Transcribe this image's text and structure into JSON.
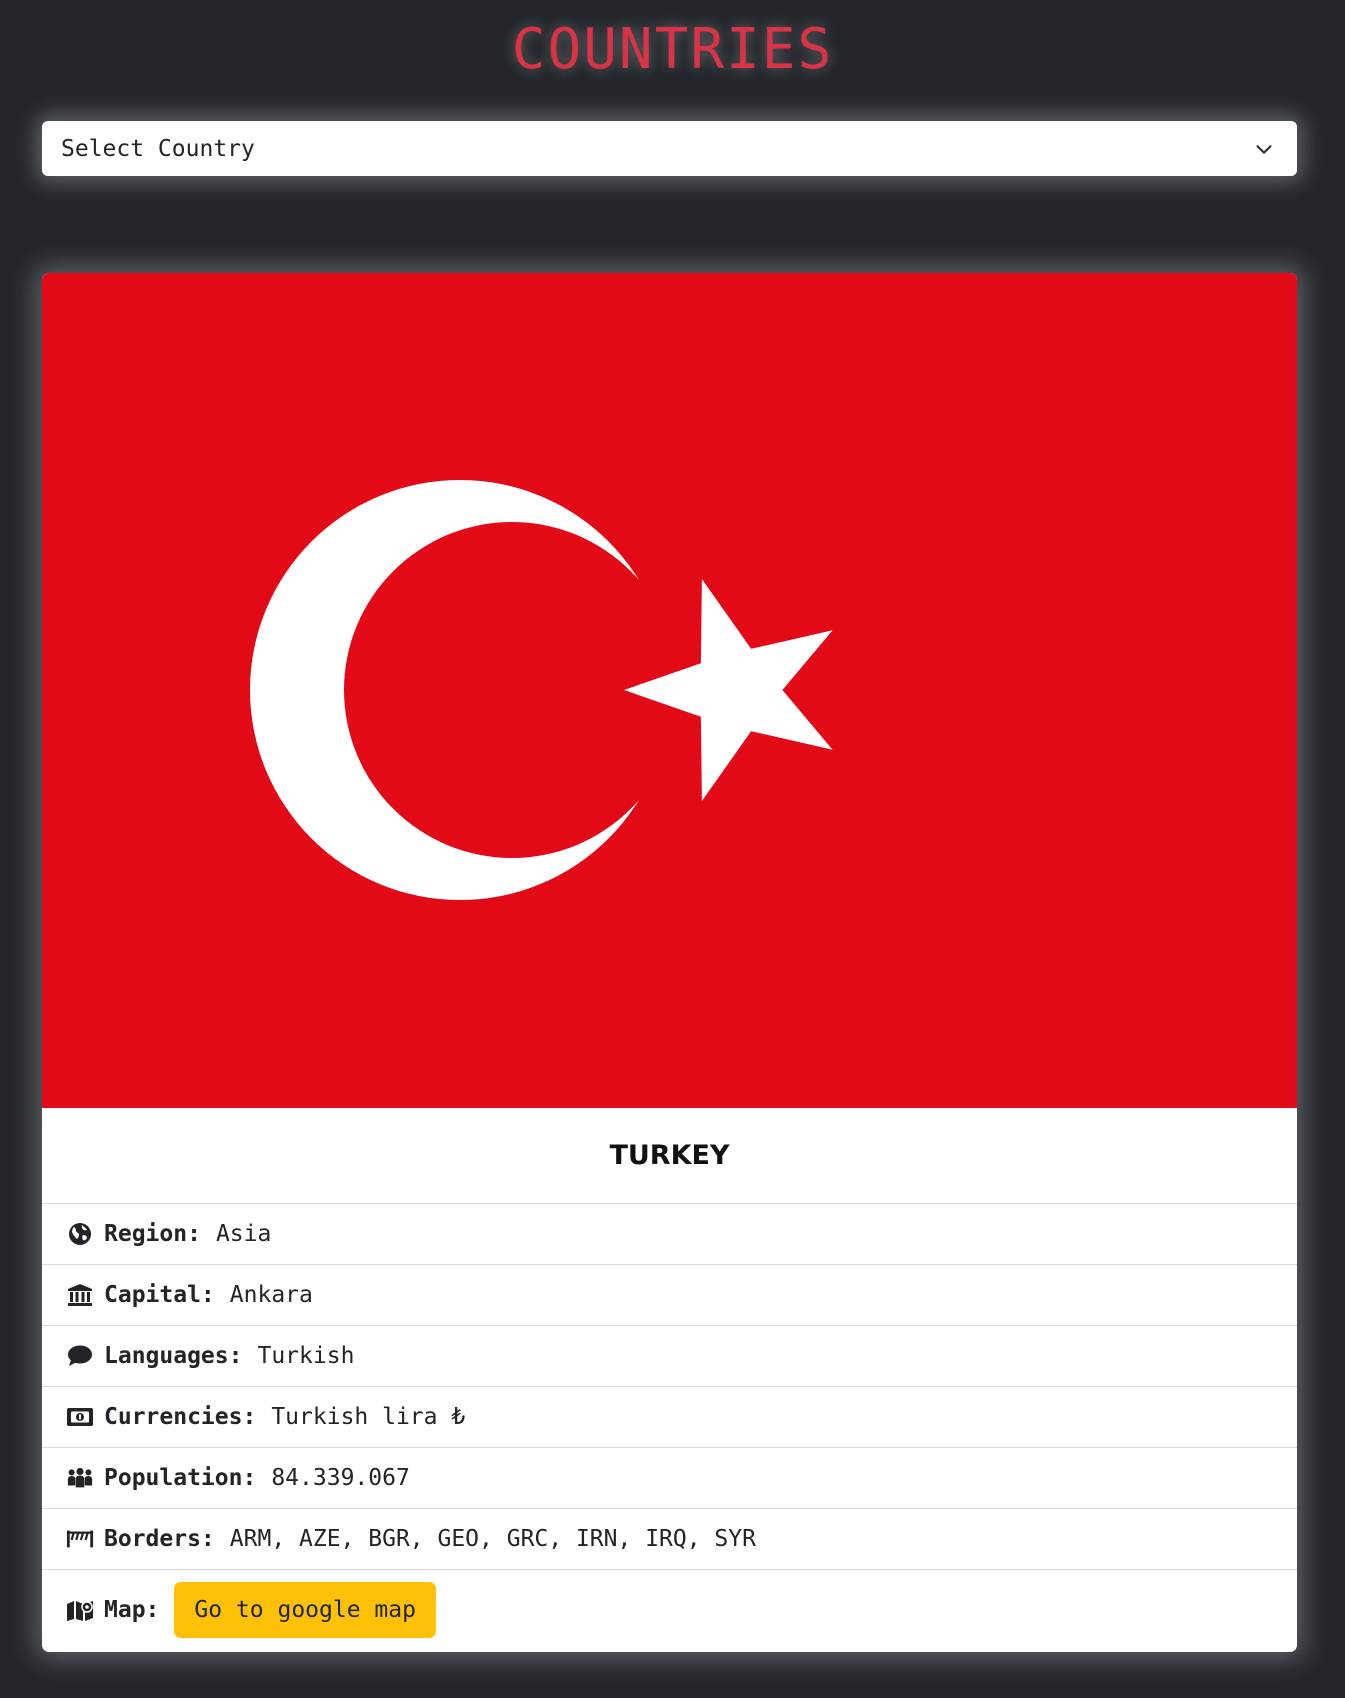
{
  "app_title": "COUNTRIES",
  "country_select": {
    "value": "Select Country"
  },
  "country": {
    "name": "TURKEY",
    "flag_icon": "turkey-flag",
    "colors": {
      "flag_red": "#e30a17",
      "accent_red": "#d93446",
      "button_yellow": "#ffc107",
      "background": "#23272c"
    }
  },
  "details": {
    "region": {
      "label": "Region:",
      "value": "Asia",
      "icon": "globe-icon"
    },
    "capital": {
      "label": "Capital:",
      "value": "Ankara",
      "icon": "landmark-icon"
    },
    "languages": {
      "label": "Languages:",
      "value": "Turkish",
      "icon": "comment-icon"
    },
    "currencies": {
      "label": "Currencies:",
      "value": "Turkish lira ₺",
      "icon": "money-bill-icon"
    },
    "population": {
      "label": "Population:",
      "value": "84.339.067",
      "icon": "people-icon"
    },
    "borders": {
      "label": "Borders:",
      "value": "ARM, AZE, BGR, GEO, GRC, IRN, IRQ, SYR",
      "icon": "fence-icon"
    },
    "map": {
      "label": "Map:",
      "button_label": "Go to google map",
      "icon": "map-icon"
    }
  }
}
